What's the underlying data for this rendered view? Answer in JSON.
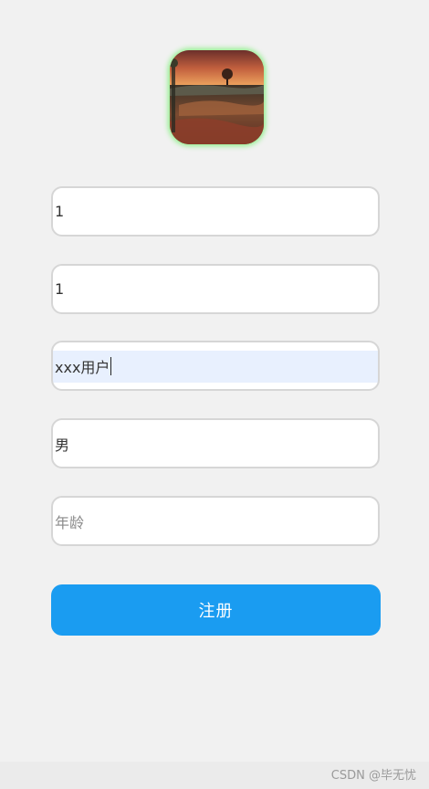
{
  "avatar": {
    "icon": "landscape-avatar-image"
  },
  "form": {
    "fields": [
      {
        "value": "1",
        "placeholder": ""
      },
      {
        "value": "1",
        "placeholder": ""
      },
      {
        "value": "xxx用户",
        "placeholder": ""
      },
      {
        "value": "男",
        "placeholder": ""
      },
      {
        "value": "",
        "placeholder": "年龄"
      }
    ],
    "submit_label": "注册"
  },
  "watermark": "CSDN @毕无忧",
  "colors": {
    "background": "#f1f1f1",
    "button": "#1a9cf1",
    "avatar_glow": "#8ff08a",
    "autofill": "#e8f0fe"
  }
}
